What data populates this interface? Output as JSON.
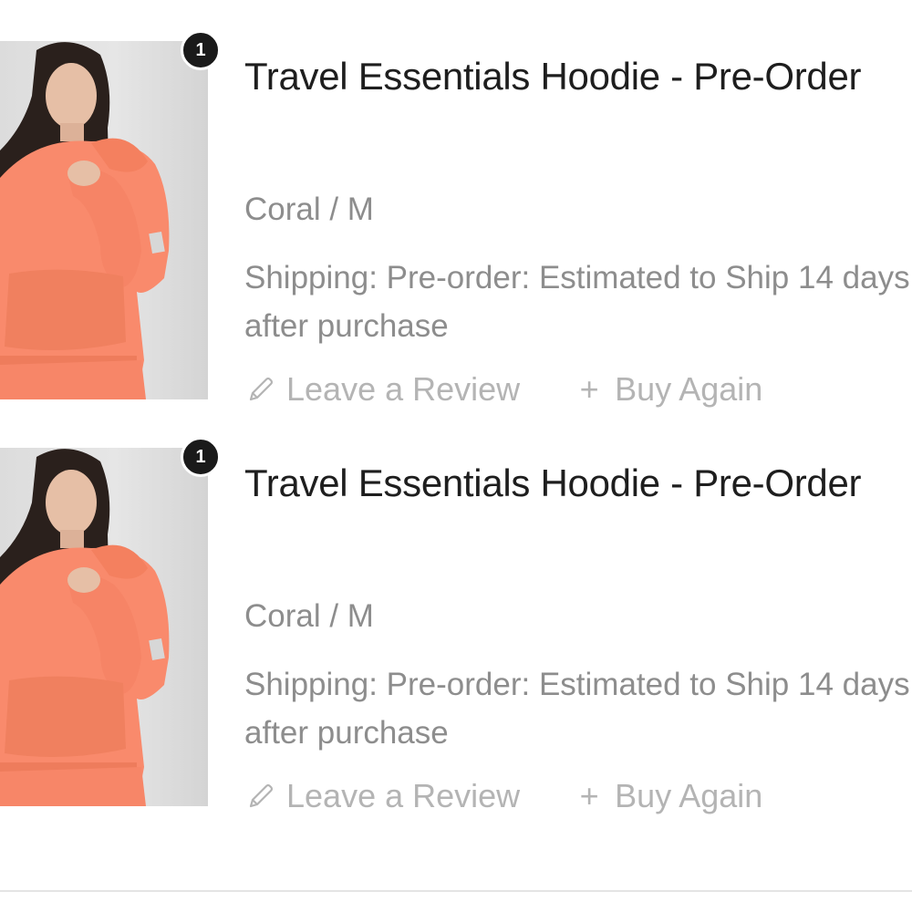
{
  "orders": [
    {
      "quantity": "1",
      "title": "Travel Essentials Hoodie - Pre-Order",
      "variant": "Coral / M",
      "shipping": "Shipping: Pre-order: Estimated to Ship 14 days after purchase",
      "review_label": "Leave a Review",
      "review_icon": "pencil-icon",
      "buy_again_label": "Buy Again",
      "buy_again_icon": "plus-icon",
      "product_color": "#f98a6c"
    },
    {
      "quantity": "1",
      "title": "Travel Essentials Hoodie - Pre-Order",
      "variant": "Coral / M",
      "shipping": "Shipping: Pre-order: Estimated to Ship 14 days after purchase",
      "review_label": "Leave a Review",
      "review_icon": "pencil-icon",
      "buy_again_label": "Buy Again",
      "buy_again_icon": "plus-icon",
      "product_color": "#f98a6c"
    }
  ],
  "colors": {
    "title_text": "#1e1e1e",
    "secondary_text": "#8d8d8d",
    "action_text": "#b4b4b4",
    "badge_background": "#1a1a1a"
  }
}
